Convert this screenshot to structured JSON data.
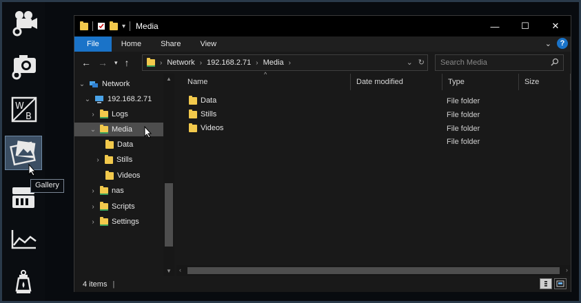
{
  "launcher": {
    "items": [
      {
        "name": "video-settings",
        "icon": "video-camera-gear-icon"
      },
      {
        "name": "camera-settings",
        "icon": "photo-camera-gear-icon"
      },
      {
        "name": "white-balance",
        "icon": "white-balance-icon",
        "label_w": "W",
        "label_b": "B"
      },
      {
        "name": "gallery",
        "icon": "gallery-icon",
        "active": true
      },
      {
        "name": "storage",
        "icon": "storage-icon"
      },
      {
        "name": "chart",
        "icon": "line-chart-icon"
      },
      {
        "name": "lantern",
        "icon": "lantern-icon"
      }
    ],
    "tooltip": "Gallery"
  },
  "window": {
    "title": "Media",
    "controls": {
      "minimize": "—",
      "maximize": "☐",
      "close": "✕"
    }
  },
  "ribbon": {
    "tabs": [
      "File",
      "Home",
      "Share",
      "View"
    ],
    "help": "?"
  },
  "address": {
    "crumbs": [
      "Network",
      "192.168.2.71",
      "Media"
    ],
    "search_placeholder": "Search Media"
  },
  "tree": {
    "items": [
      {
        "label": "Network",
        "level": 0,
        "expanded": true
      },
      {
        "label": "192.168.2.71",
        "level": 1,
        "expanded": true
      },
      {
        "label": "Logs",
        "level": 2
      },
      {
        "label": "Media",
        "level": 2,
        "expanded": true,
        "selected": true
      },
      {
        "label": "Data",
        "level": 3
      },
      {
        "label": "Stills",
        "level": 3
      },
      {
        "label": "Videos",
        "level": 3
      },
      {
        "label": "nas",
        "level": 2
      },
      {
        "label": "Scripts",
        "level": 2
      },
      {
        "label": "Settings",
        "level": 2
      }
    ]
  },
  "columns": {
    "name": "Name",
    "date": "Date modified",
    "type": "Type",
    "size": "Size"
  },
  "files": [
    {
      "name": "Data",
      "type": "File folder"
    },
    {
      "name": "Stills",
      "type": "File folder"
    },
    {
      "name": "Videos",
      "type": "File folder"
    },
    {
      "name": "",
      "type": "File folder"
    }
  ],
  "status": {
    "count": "4 items"
  },
  "colors": {
    "file_tab": "#1a73c8",
    "selected_row": "#4d4d4d",
    "folder": "#f2c94c",
    "active_launcher": "#3b4e63"
  }
}
